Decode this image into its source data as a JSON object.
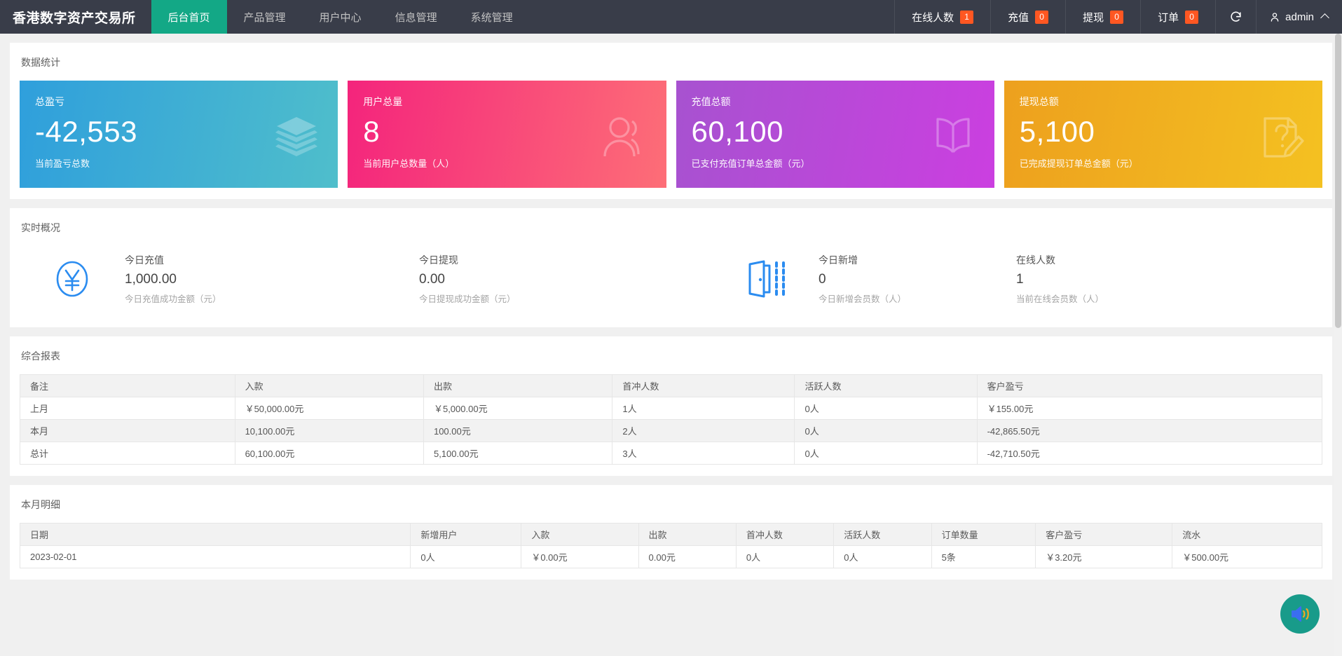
{
  "header": {
    "brand": "香港数字资产交易所",
    "nav": [
      {
        "label": "后台首页",
        "active": true
      },
      {
        "label": "产品管理",
        "active": false
      },
      {
        "label": "用户中心",
        "active": false
      },
      {
        "label": "信息管理",
        "active": false
      },
      {
        "label": "系统管理",
        "active": false
      }
    ],
    "stats": [
      {
        "label": "在线人数",
        "badge": "1"
      },
      {
        "label": "充值",
        "badge": "0"
      },
      {
        "label": "提现",
        "badge": "0"
      },
      {
        "label": "订单",
        "badge": "0"
      }
    ],
    "refresh_icon": "refresh-icon",
    "user_icon": "user-icon",
    "user_name": "admin",
    "badge_color": "#ff5722",
    "active_color": "#13a886",
    "bar_color": "#393d49"
  },
  "statistics": {
    "title": "数据统计",
    "cards": [
      {
        "label": "总盈亏",
        "value": "-42,553",
        "sub": "当前盈亏总数",
        "icon": "layers-icon",
        "color_from": "#2f9fdc",
        "color_to": "#4fbecb"
      },
      {
        "label": "用户总量",
        "value": "8",
        "sub": "当前用户总数量（人）",
        "icon": "user-group-icon",
        "color_from": "#f4247c",
        "color_to": "#fd6e77"
      },
      {
        "label": "充值总额",
        "value": "60,100",
        "sub": "已支付充值订单总金额（元）",
        "icon": "book-icon",
        "color_from": "#a752d0",
        "color_to": "#cb3fe0"
      },
      {
        "label": "提现总额",
        "value": "5,100",
        "sub": "已完成提现订单总金额（元）",
        "icon": "note-pencil-icon",
        "color_from": "#eda01e",
        "color_to": "#f4c121"
      }
    ]
  },
  "realtime": {
    "title": "实时概况",
    "icon_left": "yen-circle-icon",
    "icon_right": "door-exit-icon",
    "items": [
      {
        "title": "今日充值",
        "value": "1,000.00",
        "desc": "今日充值成功金额（元）"
      },
      {
        "title": "今日提现",
        "value": "0.00",
        "desc": "今日提现成功金额（元）"
      },
      {
        "title": "今日新增",
        "value": "0",
        "desc": "今日新增会员数（人）"
      },
      {
        "title": "在线人数",
        "value": "1",
        "desc": "当前在线会员数（人）"
      }
    ]
  },
  "report": {
    "title": "综合报表",
    "columns": [
      "备注",
      "入款",
      "出款",
      "首冲人数",
      "活跃人数",
      "客户盈亏"
    ],
    "rows": [
      [
        "上月",
        "￥50,000.00元",
        "￥5,000.00元",
        "1人",
        "0人",
        "￥155.00元"
      ],
      [
        "本月",
        "10,100.00元",
        "100.00元",
        "2人",
        "0人",
        "-42,865.50元"
      ],
      [
        "总计",
        "60,100.00元",
        "5,100.00元",
        "3人",
        "0人",
        "-42,710.50元"
      ]
    ]
  },
  "details": {
    "title": "本月明细",
    "columns": [
      "日期",
      "新增用户",
      "入款",
      "出款",
      "首冲人数",
      "活跃人数",
      "订单数量",
      "客户盈亏",
      "流水"
    ],
    "rows": [
      [
        "2023-02-01",
        "0人",
        "￥0.00元",
        "0.00元",
        "0人",
        "0人",
        "5条",
        "￥3.20元",
        "￥500.00元"
      ]
    ]
  },
  "floating": {
    "sound_icon": "sound-on-icon",
    "bg_color": "#189b8a"
  }
}
